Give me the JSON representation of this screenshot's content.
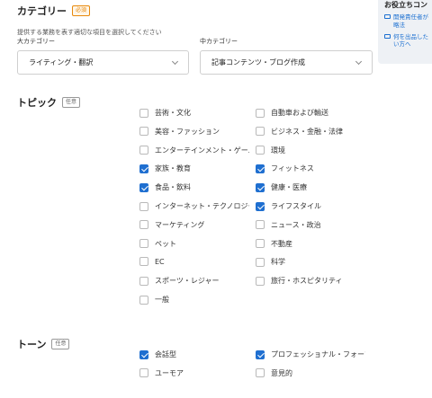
{
  "category": {
    "title": "カテゴリー",
    "badge": "必須",
    "hint": "提供する業務を表す適切な項目を選択してください",
    "major_label": "大カテゴリー",
    "major_value": "ライティング・翻訳",
    "minor_label": "中カテゴリー",
    "minor_value": "記事コンテンツ・ブログ作成"
  },
  "side_panel": {
    "title": "お役立ちコン",
    "links": [
      {
        "line1": "開発責任者が",
        "line2": "略法"
      },
      {
        "line1": "何を出品した",
        "line2": "い方へ"
      }
    ]
  },
  "topic": {
    "title": "トピック",
    "badge": "任意",
    "items": [
      {
        "label": "芸術・文化",
        "checked": false
      },
      {
        "label": "自動車および輸送",
        "checked": false
      },
      {
        "label": "美容・ファッション",
        "checked": false
      },
      {
        "label": "ビジネス・金融・法律",
        "checked": false
      },
      {
        "label": "エンターテインメント・ゲーム",
        "checked": false
      },
      {
        "label": "環境",
        "checked": false
      },
      {
        "label": "家族・教育",
        "checked": true
      },
      {
        "label": "フィットネス",
        "checked": true
      },
      {
        "label": "食品・飲料",
        "checked": true
      },
      {
        "label": "健康・医療",
        "checked": true
      },
      {
        "label": "インターネット・テクノロジー",
        "checked": false
      },
      {
        "label": "ライフスタイル",
        "checked": true
      },
      {
        "label": "マーケティング",
        "checked": false
      },
      {
        "label": "ニュース・政治",
        "checked": false
      },
      {
        "label": "ペット",
        "checked": false
      },
      {
        "label": "不動産",
        "checked": false
      },
      {
        "label": "EC",
        "checked": false
      },
      {
        "label": "科学",
        "checked": false
      },
      {
        "label": "スポーツ・レジャー",
        "checked": false
      },
      {
        "label": "旅行・ホスピタリティ",
        "checked": false
      },
      {
        "label": "一般",
        "checked": false
      }
    ]
  },
  "tone": {
    "title": "トーン",
    "badge": "任意",
    "items": [
      {
        "label": "会話型",
        "checked": true
      },
      {
        "label": "プロフェッショナル・フォーマル",
        "checked": true
      },
      {
        "label": "ユーモア",
        "checked": false
      },
      {
        "label": "意見的",
        "checked": false
      }
    ]
  },
  "colors": {
    "accent": "#1f6fd0",
    "required": "#e8890c"
  }
}
